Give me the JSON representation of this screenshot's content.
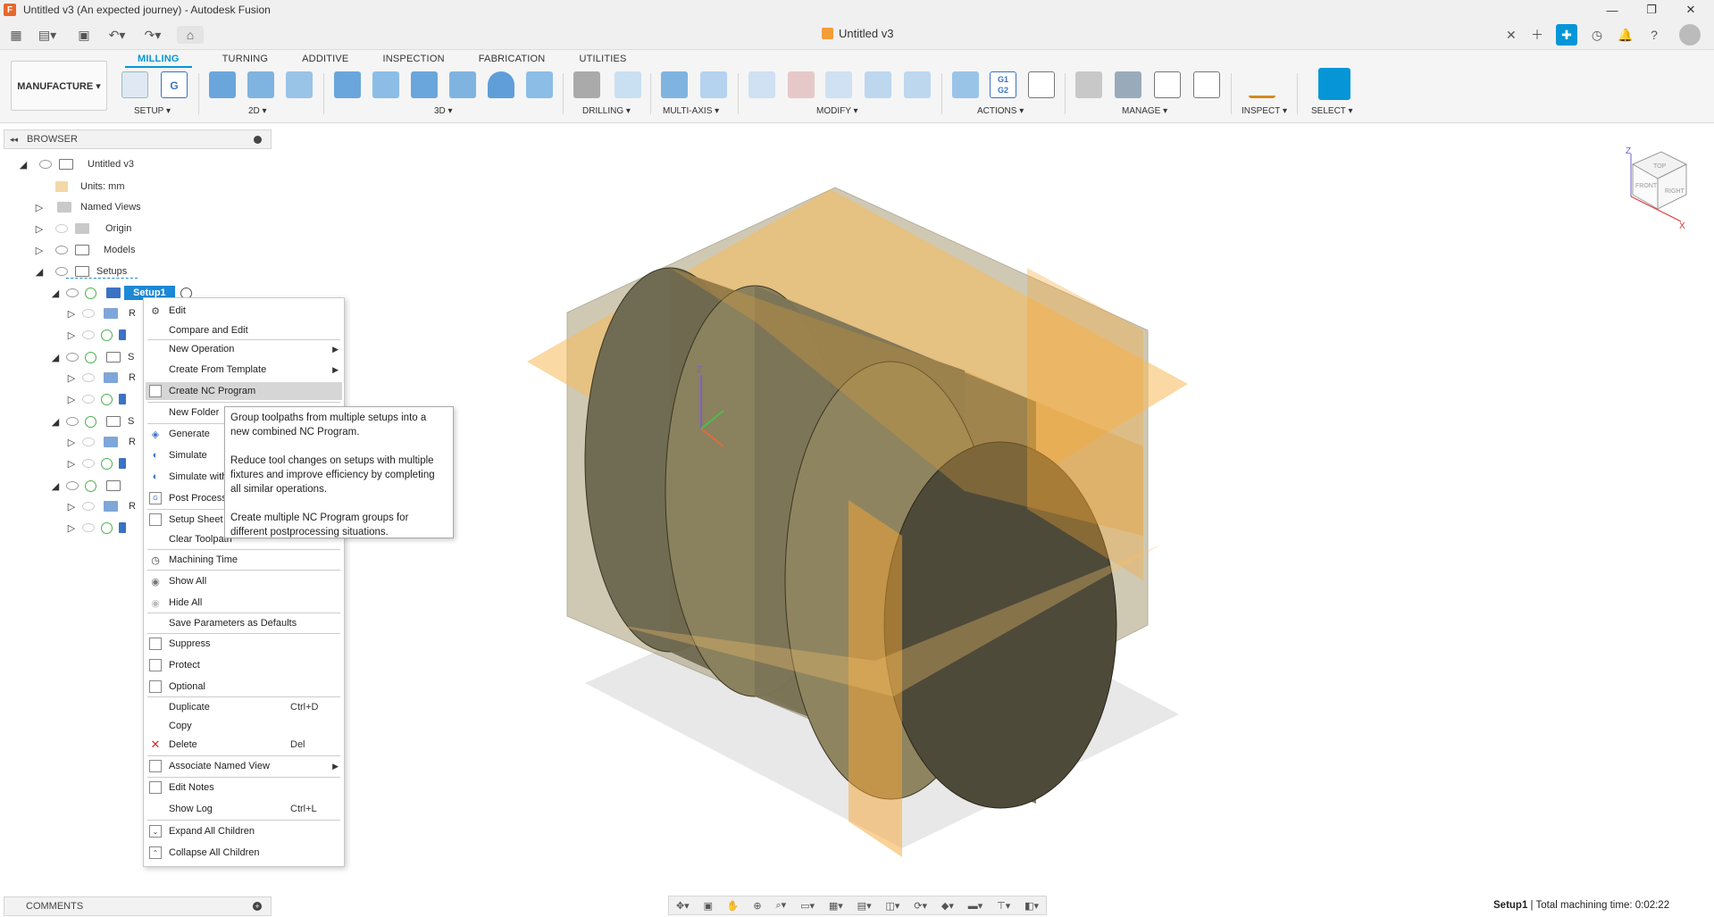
{
  "window": {
    "title": "Untitled v3 (An expected journey) - Autodesk Fusion",
    "app_logo": "F"
  },
  "document_tab": {
    "label": "Untitled v3"
  },
  "workspace": {
    "label": "MANUFACTURE ▾"
  },
  "ribbon_tabs": [
    "MILLING",
    "TURNING",
    "ADDITIVE",
    "INSPECTION",
    "FABRICATION",
    "UTILITIES"
  ],
  "ribbon_groups": {
    "setup": "SETUP ▾",
    "twod": "2D ▾",
    "threed": "3D ▾",
    "drilling": "DRILLING ▾",
    "multiaxis": "MULTI-AXIS ▾",
    "modify": "MODIFY ▾",
    "actions": "ACTIONS ▾",
    "manage": "MANAGE ▾",
    "inspect": "INSPECT ▾",
    "select": "SELECT ▾"
  },
  "actions_g1g2": "G1\nG2",
  "browser": {
    "title": "BROWSER",
    "root": "Untitled v3",
    "units": "Units: mm",
    "named_views": "Named Views",
    "origin": "Origin",
    "models": "Models",
    "setups": "Setups",
    "setup1": "Setup1",
    "trunc_r": "R",
    "trunc_s": "S"
  },
  "context_menu": {
    "items": [
      {
        "label": "Edit"
      },
      {
        "label": "Compare and Edit"
      },
      {
        "label": "New Operation"
      },
      {
        "label": "Create From Template"
      },
      {
        "label": "Create NC Program"
      },
      {
        "label": "New Folder"
      },
      {
        "label": "Generate"
      },
      {
        "label": "Simulate"
      },
      {
        "label": "Simulate with"
      },
      {
        "label": "Post Process"
      },
      {
        "label": "Setup Sheet"
      },
      {
        "label": "Clear Toolpath"
      },
      {
        "label": "Machining Time"
      },
      {
        "label": "Show All"
      },
      {
        "label": "Hide All"
      },
      {
        "label": "Save Parameters as Defaults"
      },
      {
        "label": "Suppress"
      },
      {
        "label": "Protect"
      },
      {
        "label": "Optional"
      },
      {
        "label": "Duplicate",
        "shortcut": "Ctrl+D"
      },
      {
        "label": "Copy"
      },
      {
        "label": "Delete",
        "shortcut": "Del"
      },
      {
        "label": "Associate Named View"
      },
      {
        "label": "Edit Notes"
      },
      {
        "label": "Show Log",
        "shortcut": "Ctrl+L"
      },
      {
        "label": "Expand All Children"
      },
      {
        "label": "Collapse All Children"
      }
    ]
  },
  "tooltip": {
    "p1": "Group toolpaths from multiple setups into a new combined NC Program.",
    "p2": "Reduce tool changes on setups with multiple fixtures and improve efficiency by completing all similar operations.",
    "p3": "Create multiple NC Program groups for different postprocessing situations."
  },
  "viewcube": {
    "top": "TOP",
    "front": "FRONT",
    "right": "RIGHT",
    "z": "Z",
    "x": "X",
    "origin_z": "Z"
  },
  "comments": {
    "title": "COMMENTS"
  },
  "status": {
    "setup": "Setup1",
    "sep": " | ",
    "time": "Total machining time: 0:02:22"
  }
}
